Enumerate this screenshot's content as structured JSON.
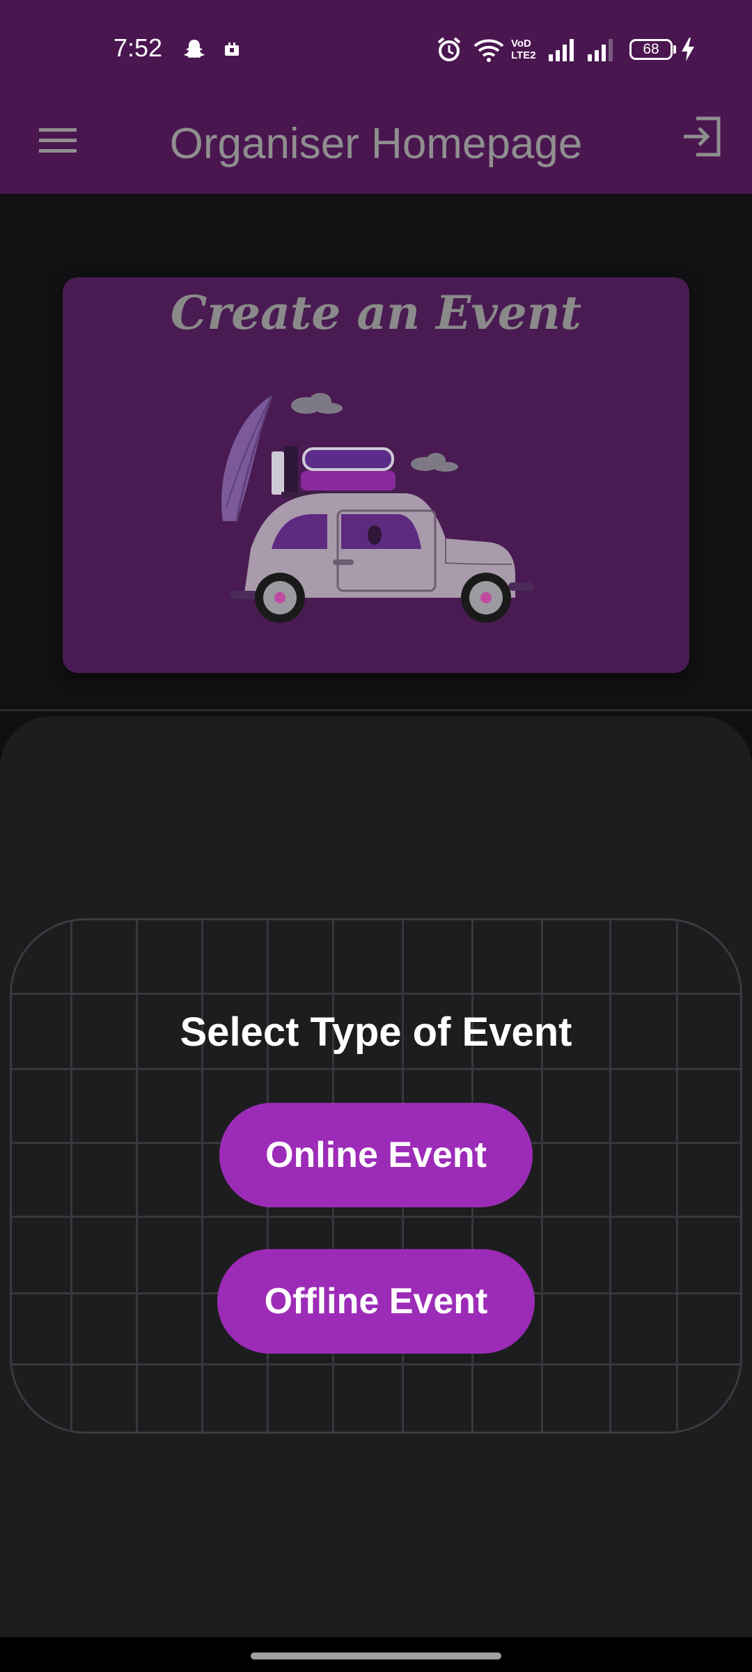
{
  "status_bar": {
    "time": "7:52",
    "network_label": "VoD LTE2",
    "battery_level": "68",
    "icons": [
      "snapchat-icon",
      "notification-icon",
      "alarm-icon",
      "wifi-icon",
      "signal-icon",
      "signal-icon",
      "battery-icon",
      "charging-icon"
    ]
  },
  "app_bar": {
    "title": "Organiser Homepage",
    "menu_icon": "menu-icon",
    "logout_icon": "logout-icon"
  },
  "hero_card": {
    "title": "Create an Event",
    "illustration": "car-with-luggage-illustration"
  },
  "event_type": {
    "heading": "Select Type of Event",
    "online_label": "Online Event",
    "offline_label": "Offline Event"
  },
  "colors": {
    "primary": "#4a1650",
    "accent_button": "#9c2cb7",
    "sheet_bg": "#1d1d20"
  }
}
